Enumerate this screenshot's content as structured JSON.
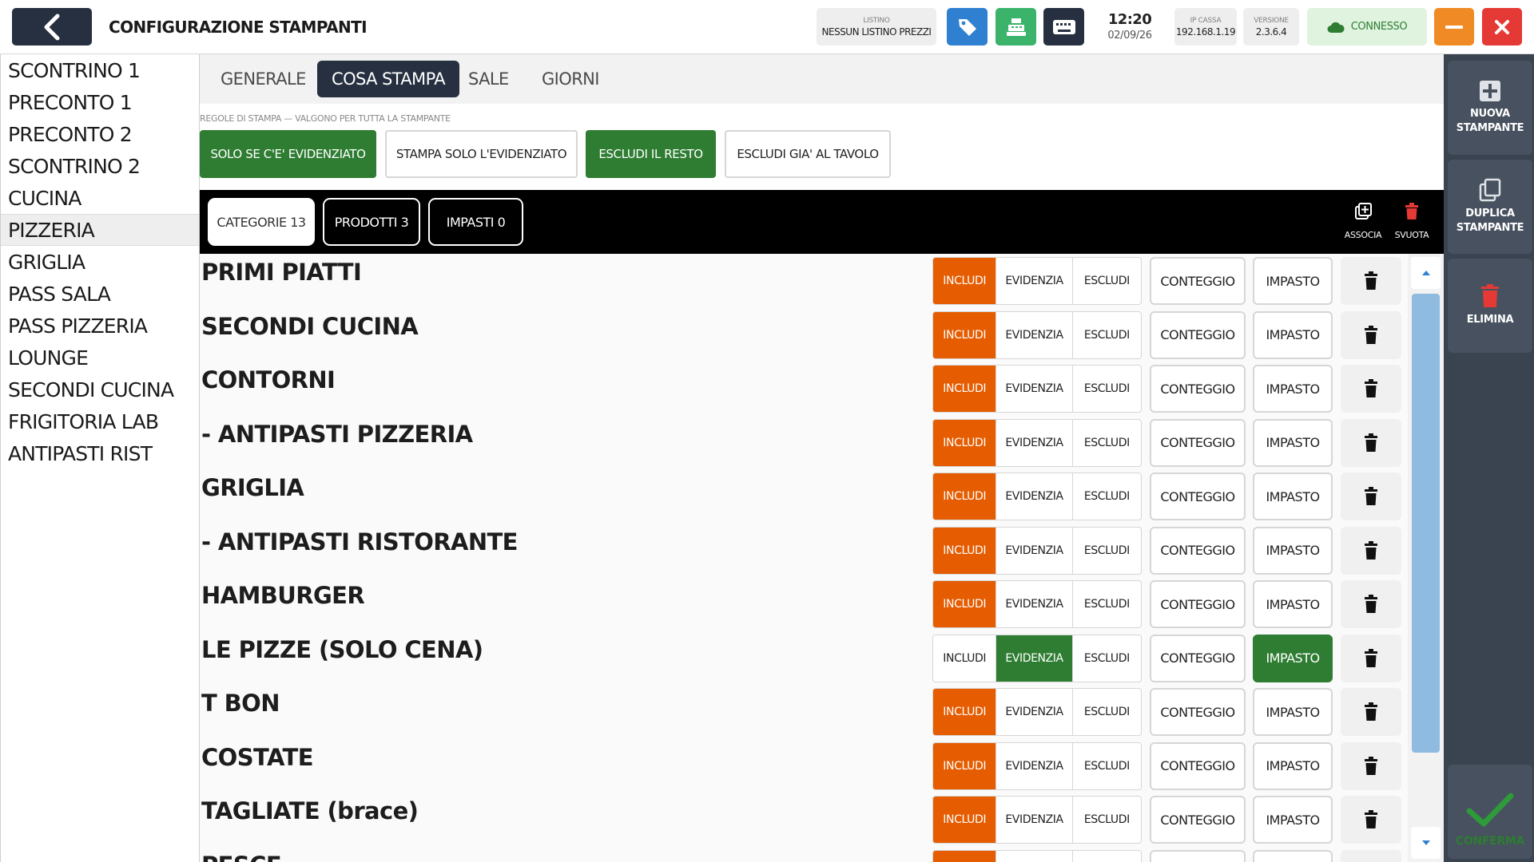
{
  "header": {
    "title": "CONFIGURAZIONE STAMPANTI",
    "price_list": {
      "label": "LISTINO",
      "value": "NESSUN LISTINO PREZZI"
    },
    "time": "12:20",
    "date": "02/09/26",
    "ip": {
      "label": "IP CASSA",
      "value": "192.168.1.19"
    },
    "version": {
      "label": "VERSIONE",
      "value": "2.3.6.4"
    },
    "connection": "CONNESSO",
    "colors": {
      "dark": "#263040",
      "green": "#2e7d32",
      "orange": "#e65c00",
      "blue": "#2f80d0",
      "red": "#e53935"
    }
  },
  "printers": [
    {
      "label": "SCONTRINO 1"
    },
    {
      "label": "PRECONTO 1"
    },
    {
      "label": "PRECONTO 2"
    },
    {
      "label": "SCONTRINO 2"
    },
    {
      "label": "CUCINA"
    },
    {
      "label": "PIZZERIA",
      "active": true
    },
    {
      "label": "GRIGLIA"
    },
    {
      "label": "PASS SALA"
    },
    {
      "label": "PASS PIZZERIA"
    },
    {
      "label": "LOUNGE"
    },
    {
      "label": "SECONDI CUCINA"
    },
    {
      "label": "FRIGITORIA LAB"
    },
    {
      "label": "ANTIPASTI RIST"
    }
  ],
  "tabs": [
    {
      "label": "GENERALE"
    },
    {
      "label": "COSA STAMPA",
      "active": true
    },
    {
      "label": "SALE"
    },
    {
      "label": "GIORNI"
    }
  ],
  "rules": {
    "caption": "REGOLE DI STAMPA — VALGONO PER TUTTA LA STAMPANTE",
    "buttons": [
      {
        "label": "SOLO SE C'E' EVIDENZIATO",
        "on": true
      },
      {
        "label": "STAMPA SOLO L'EVIDENZIATO",
        "on": false
      },
      {
        "label": "ESCLUDI IL RESTO",
        "on": true
      },
      {
        "label": "ESCLUDI GIA' AL TAVOLO",
        "on": false
      }
    ]
  },
  "filters": [
    {
      "label": "CATEGORIE 13",
      "active": true
    },
    {
      "label": "PRODOTTI 3",
      "active": false
    },
    {
      "label": "IMPASTI 0",
      "active": false
    }
  ],
  "bar_actions": {
    "associa": "ASSOCIA",
    "svuota": "SVUOTA"
  },
  "row_labels": {
    "includi": "INCLUDI",
    "evidenzia": "EVIDENZIA",
    "escludi": "ESCLUDI",
    "conteggio": "CONTEGGIO",
    "impasto": "IMPASTO"
  },
  "categories": [
    {
      "name": "PRIMI PIATTI",
      "mode": "includi",
      "impasto": false
    },
    {
      "name": "SECONDI CUCINA",
      "mode": "includi",
      "impasto": false
    },
    {
      "name": "CONTORNI",
      "mode": "includi",
      "impasto": false
    },
    {
      "name": "- ANTIPASTI PIZZERIA",
      "mode": "includi",
      "impasto": false
    },
    {
      "name": "GRIGLIA",
      "mode": "includi",
      "impasto": false
    },
    {
      "name": "- ANTIPASTI RISTORANTE",
      "mode": "includi",
      "impasto": false
    },
    {
      "name": "HAMBURGER",
      "mode": "includi",
      "impasto": false
    },
    {
      "name": "LE PIZZE (SOLO CENA)",
      "mode": "evidenzia",
      "impasto": true
    },
    {
      "name": "T BON",
      "mode": "includi",
      "impasto": false
    },
    {
      "name": "COSTATE",
      "mode": "includi",
      "impasto": false
    },
    {
      "name": "TAGLIATE (brace)",
      "mode": "includi",
      "impasto": false
    },
    {
      "name": "PESCE",
      "mode": "includi",
      "impasto": false
    }
  ],
  "sidebar_actions": {
    "new_printer": "NUOVA STAMPANTE",
    "duplicate_printer": "DUPLICA STAMPANTE",
    "delete": "ELIMINA",
    "confirm": "CONFERMA"
  }
}
